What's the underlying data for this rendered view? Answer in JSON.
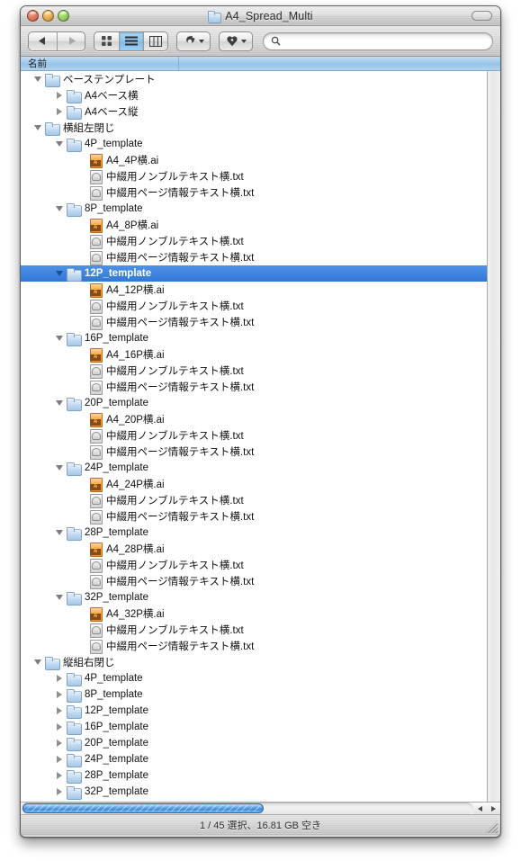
{
  "window": {
    "title": "A4_Spread_Multi",
    "title_icon": "folder-icon",
    "controls": {
      "close": "close-button",
      "minimize": "minimize-button",
      "zoom": "zoom-button"
    }
  },
  "toolbar": {
    "back_icon": "back-arrow-icon",
    "forward_icon": "forward-arrow-icon",
    "view_icon_label": "icon-view-icon",
    "view_list_label": "list-view-icon",
    "view_column_label": "column-view-icon",
    "action_icon": "gear-icon",
    "burn_icon": "burn-icon",
    "search_icon": "search-icon",
    "search_value": "",
    "search_placeholder": ""
  },
  "list_header": {
    "name": "名前",
    "rest": ""
  },
  "status": {
    "text": "1 / 45 選択、16.81 GB 空き"
  },
  "scrollbar": {
    "left_arrow": "scroll-left-arrow-icon",
    "right_arrow": "scroll-right-arrow-icon"
  },
  "colors": {
    "selection": "#3277d6",
    "header": "#9ec7e8",
    "ai_icon": "#f4a93c",
    "folder_icon": "#bcd6ee"
  },
  "rows": [
    {
      "depth": 0,
      "twisty": "down",
      "icon": "folder",
      "label": "ベーステンプレート",
      "selected": false
    },
    {
      "depth": 1,
      "twisty": "right",
      "icon": "folder",
      "label": "A4ベース横",
      "selected": false
    },
    {
      "depth": 1,
      "twisty": "right",
      "icon": "folder",
      "label": "A4ベース縦",
      "selected": false
    },
    {
      "depth": 0,
      "twisty": "down",
      "icon": "folder",
      "label": "横組左閉じ",
      "selected": false
    },
    {
      "depth": 1,
      "twisty": "down",
      "icon": "folder",
      "label": "4P_template",
      "selected": false
    },
    {
      "depth": 2,
      "twisty": "none",
      "icon": "ai",
      "label": "A4_4P横.ai",
      "selected": false
    },
    {
      "depth": 2,
      "twisty": "none",
      "icon": "txt",
      "label": "中綴用ノンブルテキスト横.txt",
      "selected": false
    },
    {
      "depth": 2,
      "twisty": "none",
      "icon": "txt",
      "label": "中綴用ページ情報テキスト横.txt",
      "selected": false
    },
    {
      "depth": 1,
      "twisty": "down",
      "icon": "folder",
      "label": "8P_template",
      "selected": false
    },
    {
      "depth": 2,
      "twisty": "none",
      "icon": "ai",
      "label": "A4_8P横.ai",
      "selected": false
    },
    {
      "depth": 2,
      "twisty": "none",
      "icon": "txt",
      "label": "中綴用ノンブルテキスト横.txt",
      "selected": false
    },
    {
      "depth": 2,
      "twisty": "none",
      "icon": "txt",
      "label": "中綴用ページ情報テキスト横.txt",
      "selected": false
    },
    {
      "depth": 1,
      "twisty": "down",
      "icon": "folder",
      "label": "12P_template",
      "selected": true
    },
    {
      "depth": 2,
      "twisty": "none",
      "icon": "ai",
      "label": "A4_12P横.ai",
      "selected": false
    },
    {
      "depth": 2,
      "twisty": "none",
      "icon": "txt",
      "label": "中綴用ノンブルテキスト横.txt",
      "selected": false
    },
    {
      "depth": 2,
      "twisty": "none",
      "icon": "txt",
      "label": "中綴用ページ情報テキスト横.txt",
      "selected": false
    },
    {
      "depth": 1,
      "twisty": "down",
      "icon": "folder",
      "label": "16P_template",
      "selected": false
    },
    {
      "depth": 2,
      "twisty": "none",
      "icon": "ai",
      "label": "A4_16P横.ai",
      "selected": false
    },
    {
      "depth": 2,
      "twisty": "none",
      "icon": "txt",
      "label": "中綴用ノンブルテキスト横.txt",
      "selected": false
    },
    {
      "depth": 2,
      "twisty": "none",
      "icon": "txt",
      "label": "中綴用ページ情報テキスト横.txt",
      "selected": false
    },
    {
      "depth": 1,
      "twisty": "down",
      "icon": "folder",
      "label": "20P_template",
      "selected": false
    },
    {
      "depth": 2,
      "twisty": "none",
      "icon": "ai",
      "label": "A4_20P横.ai",
      "selected": false
    },
    {
      "depth": 2,
      "twisty": "none",
      "icon": "txt",
      "label": "中綴用ノンブルテキスト横.txt",
      "selected": false
    },
    {
      "depth": 2,
      "twisty": "none",
      "icon": "txt",
      "label": "中綴用ページ情報テキスト横.txt",
      "selected": false
    },
    {
      "depth": 1,
      "twisty": "down",
      "icon": "folder",
      "label": "24P_template",
      "selected": false
    },
    {
      "depth": 2,
      "twisty": "none",
      "icon": "ai",
      "label": "A4_24P横.ai",
      "selected": false
    },
    {
      "depth": 2,
      "twisty": "none",
      "icon": "txt",
      "label": "中綴用ノンブルテキスト横.txt",
      "selected": false
    },
    {
      "depth": 2,
      "twisty": "none",
      "icon": "txt",
      "label": "中綴用ページ情報テキスト横.txt",
      "selected": false
    },
    {
      "depth": 1,
      "twisty": "down",
      "icon": "folder",
      "label": "28P_template",
      "selected": false
    },
    {
      "depth": 2,
      "twisty": "none",
      "icon": "ai",
      "label": "A4_28P横.ai",
      "selected": false
    },
    {
      "depth": 2,
      "twisty": "none",
      "icon": "txt",
      "label": "中綴用ノンブルテキスト横.txt",
      "selected": false
    },
    {
      "depth": 2,
      "twisty": "none",
      "icon": "txt",
      "label": "中綴用ページ情報テキスト横.txt",
      "selected": false
    },
    {
      "depth": 1,
      "twisty": "down",
      "icon": "folder",
      "label": "32P_template",
      "selected": false
    },
    {
      "depth": 2,
      "twisty": "none",
      "icon": "ai",
      "label": "A4_32P横.ai",
      "selected": false
    },
    {
      "depth": 2,
      "twisty": "none",
      "icon": "txt",
      "label": "中綴用ノンブルテキスト横.txt",
      "selected": false
    },
    {
      "depth": 2,
      "twisty": "none",
      "icon": "txt",
      "label": "中綴用ページ情報テキスト横.txt",
      "selected": false
    },
    {
      "depth": 0,
      "twisty": "down",
      "icon": "folder",
      "label": "縦組右閉じ",
      "selected": false
    },
    {
      "depth": 1,
      "twisty": "right",
      "icon": "folder",
      "label": "4P_template",
      "selected": false
    },
    {
      "depth": 1,
      "twisty": "right",
      "icon": "folder",
      "label": "8P_template",
      "selected": false
    },
    {
      "depth": 1,
      "twisty": "right",
      "icon": "folder",
      "label": "12P_template",
      "selected": false
    },
    {
      "depth": 1,
      "twisty": "right",
      "icon": "folder",
      "label": "16P_template",
      "selected": false
    },
    {
      "depth": 1,
      "twisty": "right",
      "icon": "folder",
      "label": "20P_template",
      "selected": false
    },
    {
      "depth": 1,
      "twisty": "right",
      "icon": "folder",
      "label": "24P_template",
      "selected": false
    },
    {
      "depth": 1,
      "twisty": "right",
      "icon": "folder",
      "label": "28P_template",
      "selected": false
    },
    {
      "depth": 1,
      "twisty": "right",
      "icon": "folder",
      "label": "32P_template",
      "selected": false
    }
  ]
}
